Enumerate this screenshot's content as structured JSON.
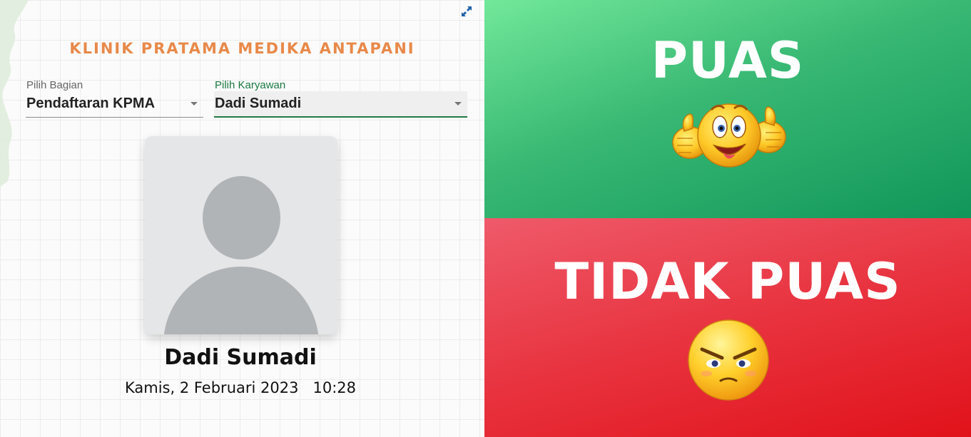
{
  "header": {
    "clinic_name": "KLINIK PRATAMA MEDIKA ANTAPANI"
  },
  "filters": {
    "department": {
      "label": "Pilih Bagian",
      "value": "Pendaftaran KPMA"
    },
    "employee": {
      "label": "Pilih Karyawan",
      "value": "Dadi Sumadi"
    }
  },
  "profile": {
    "name": "Dadi Sumadi",
    "date": "Kamis, 2 Februari 2023",
    "time": "10:28"
  },
  "rating": {
    "satisfied_label": "PUAS",
    "unsatisfied_label": "TIDAK PUAS"
  },
  "icons": {
    "fullscreen": "expand-arrows-icon",
    "satisfied": "thumbs-up-smiley-icon",
    "unsatisfied": "angry-face-icon"
  },
  "colors": {
    "title": "#e8894a",
    "active_field": "#1f7a44",
    "satisfied_bg": "#38b873",
    "unsatisfied_bg": "#e8333f"
  }
}
